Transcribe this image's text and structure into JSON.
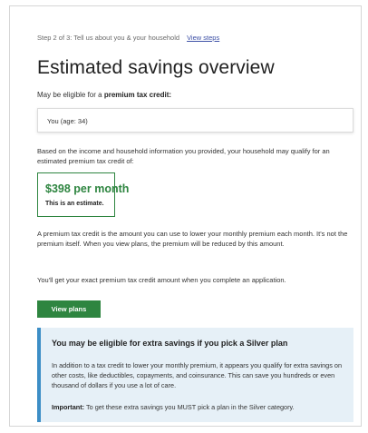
{
  "header": {
    "step_text": "Step 2 of 3: Tell us about you & your household",
    "view_steps_link": "View steps"
  },
  "page_title": "Estimated savings overview",
  "eligibility": {
    "prefix": "May be eligible for a",
    "credit_label": "premium tax credit:"
  },
  "household": {
    "member_label": "You (age: 34)"
  },
  "qualify_text": "Based on the income and household information you provided, your household may qualify for an estimated premium tax credit of:",
  "estimate": {
    "amount": "$398 per month",
    "note": "This is an estimate."
  },
  "explanation_text": "A premium tax credit is the amount you can use to lower your monthly premium each month. It's not the premium itself. When you view plans, the premium will be reduced by this amount.",
  "exact_amount_text": "You'll get your exact premium tax credit amount when you complete an application.",
  "view_plans_button": "View plans",
  "silver_alert": {
    "title": "You may be eligible for extra savings if you pick a Silver plan",
    "body": "In addition to a tax credit to lower your monthly premium, it appears you qualify for extra savings on other costs, like deductibles, copayments, and coinsurance. This can save you hundreds or even thousand of dollars if you use a lot of care.",
    "important_label": "Important:",
    "important_text": "To get these extra savings you MUST pick a plan in the Silver category."
  },
  "colors": {
    "accent_green": "#2e8540",
    "alert_background": "#e6f0f7",
    "alert_border": "#3c8ec6",
    "link_blue": "#3c4fa5"
  }
}
